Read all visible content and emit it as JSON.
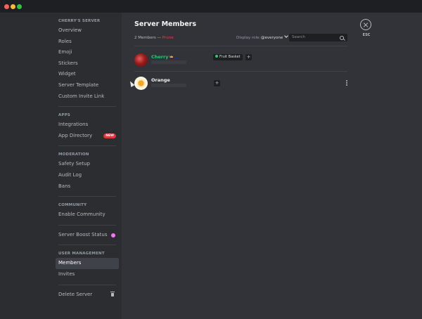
{
  "window": {
    "controls": [
      {
        "name": "close",
        "color": "#ff5f57"
      },
      {
        "name": "minimize",
        "color": "#febc2e"
      },
      {
        "name": "zoom",
        "color": "#28c840"
      }
    ]
  },
  "sidebar": {
    "server_heading": "CHERRY'S SERVER",
    "server_items": [
      "Overview",
      "Roles",
      "Emoji",
      "Stickers",
      "Widget",
      "Server Template",
      "Custom Invite Link"
    ],
    "apps_heading": "APPS",
    "apps_items": [
      "Integrations",
      "App Directory"
    ],
    "new_badge": "NEW",
    "moderation_heading": "MODERATION",
    "moderation_items": [
      "Safety Setup",
      "Audit Log",
      "Bans"
    ],
    "community_heading": "COMMUNITY",
    "community_items": [
      "Enable Community"
    ],
    "boost_item": "Server Boost Status",
    "user_mgmt_heading": "USER MANAGEMENT",
    "user_mgmt_items": [
      "Members",
      "Invites"
    ],
    "delete_item": "Delete Server",
    "active_item": "Members"
  },
  "main": {
    "title": "Server Members",
    "count": "2 Members",
    "count_sep": " — ",
    "prune": "Prune",
    "display_role_label": "Display role:",
    "display_role_value": "@everyone",
    "search_placeholder": "Search",
    "members": [
      {
        "name": "Cherry",
        "name_color": "#2dc770",
        "owner": true,
        "role": "Fruit Basket",
        "role_color": "#2ecc71"
      },
      {
        "name": "Orange",
        "name_color": "#f2f3f5",
        "owner": false,
        "role": "",
        "role_color": ""
      }
    ]
  },
  "esc": {
    "label": "ESC"
  }
}
